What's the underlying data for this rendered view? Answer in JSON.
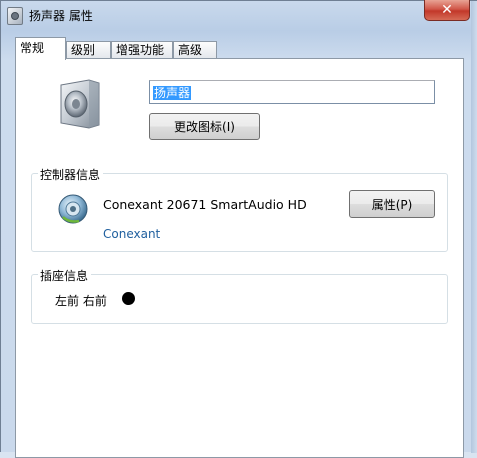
{
  "window": {
    "title": "扬声器 属性",
    "close_glyph": "✕"
  },
  "tabs": [
    {
      "label": "常规",
      "active": true
    },
    {
      "label": "级别",
      "active": false
    },
    {
      "label": "增强功能",
      "active": false
    },
    {
      "label": "高级",
      "active": false
    }
  ],
  "general": {
    "device_name": "扬声器",
    "change_icon_label": "更改图标(I)"
  },
  "controller": {
    "group_label": "控制器信息",
    "device": "Conexant 20671 SmartAudio HD",
    "vendor": "Conexant",
    "properties_label": "属性(P)"
  },
  "jack": {
    "group_label": "插座信息",
    "positions": "左前 右前",
    "color": "#000000"
  },
  "icons": [
    "speaker-icon",
    "sound-device-icon",
    "window-icon",
    "close-icon"
  ]
}
